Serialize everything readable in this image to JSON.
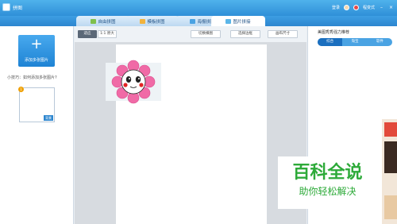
{
  "window": {
    "title": "拼图"
  },
  "titlebar": {
    "login": "登录",
    "menu": "程变式"
  },
  "tabs": [
    {
      "label": "自由拼图",
      "active": false
    },
    {
      "label": "模板拼图",
      "active": false
    },
    {
      "label": "海报拼图",
      "active": false
    },
    {
      "label": "图片拼接",
      "active": true
    }
  ],
  "left_panel": {
    "add_button_label": "添加多张图片",
    "tip": "小技巧：如何添加多张图片?",
    "thumbnail": {
      "badge": "1",
      "tag": "背景"
    }
  },
  "toolbar": {
    "fit": "适应",
    "original": "1:1 原大",
    "switch_orientation": "切换横图",
    "border": "选择边框",
    "size": "画布尺寸"
  },
  "right_panel": {
    "title": "美图秀秀强力推荐",
    "tabs": [
      "综合",
      "淘宝",
      "软件"
    ],
    "active_tab": 0
  },
  "watermark": {
    "main": "百科全说",
    "sub": "助你轻松解决"
  },
  "colors": {
    "titlebar": "#2f8fd8",
    "accent": "#1e83d4",
    "watermark": "#2daa39",
    "petal": "#f06aa6"
  }
}
